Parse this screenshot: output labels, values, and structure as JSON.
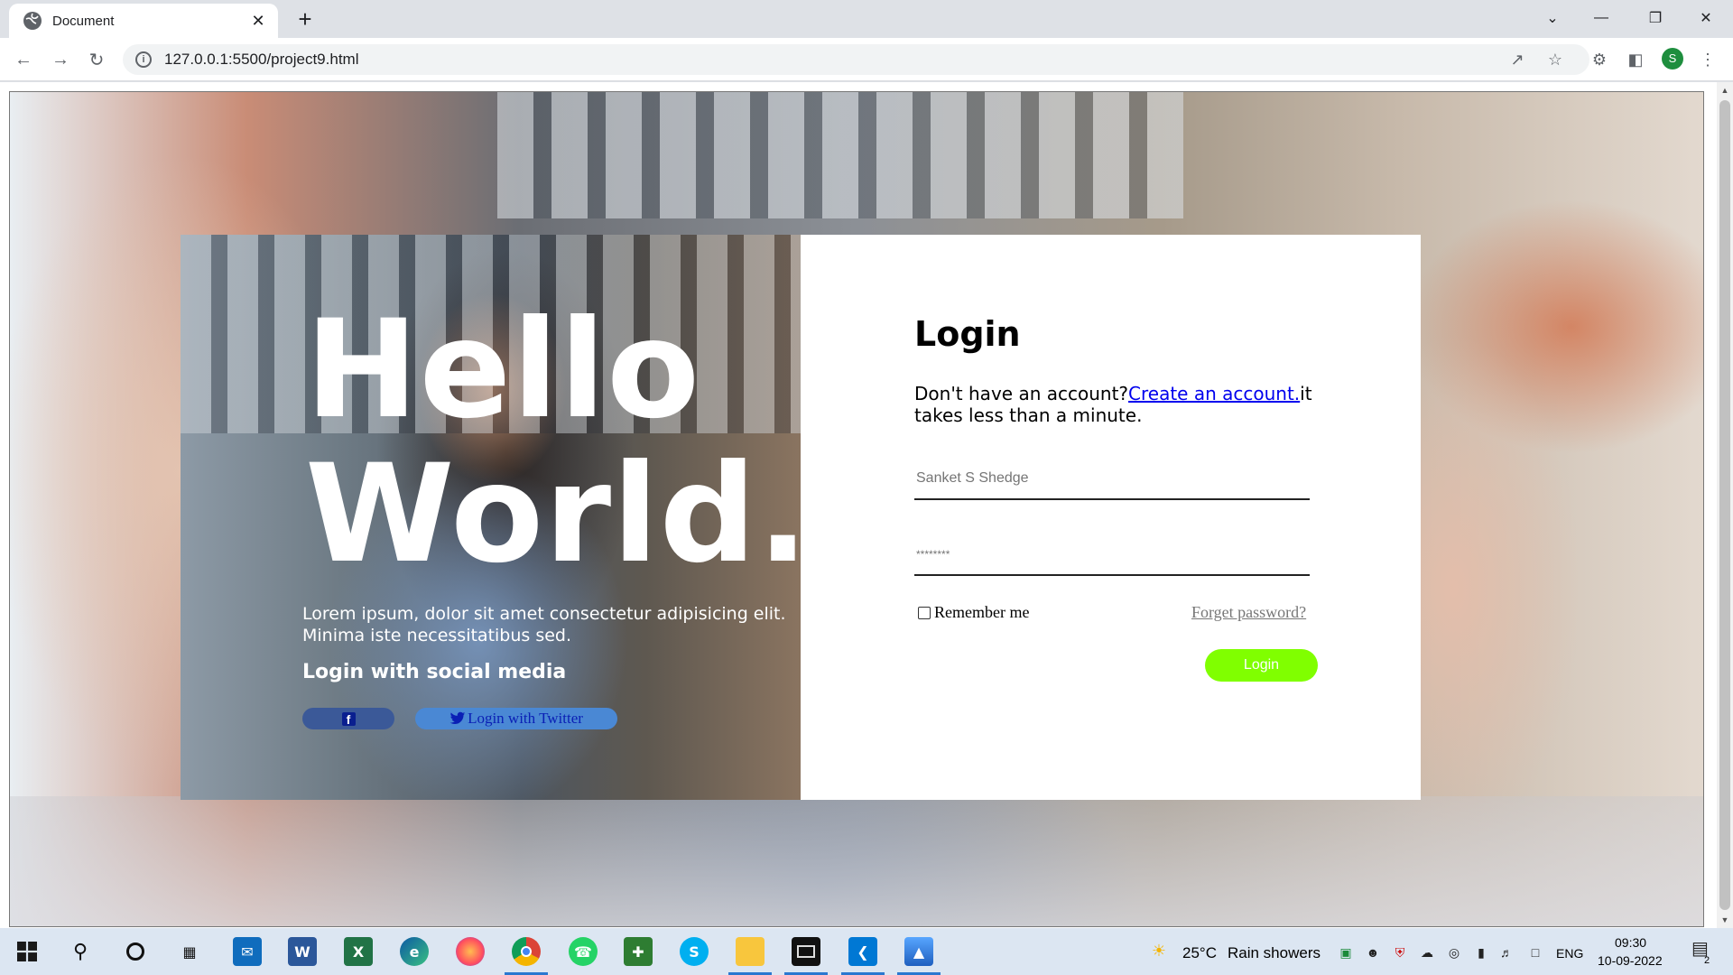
{
  "browser": {
    "tab_title": "Document",
    "tab_close": "✕",
    "new_tab": "+",
    "url": "127.0.0.1:5500/project9.html",
    "profile_initial": "S",
    "window_controls": [
      "⌄",
      "—",
      "❐",
      "✕"
    ]
  },
  "hero": {
    "line1": "Hello",
    "line2": "World.",
    "lorem": "Lorem ipsum, dolor sit amet consectetur adipisicing elit. Minima iste necessitatibus sed.",
    "social_title": "Login with social media",
    "facebook_glyph": "f",
    "twitter_label": "Login with Twitter"
  },
  "login": {
    "title": "Login",
    "signup_prefix": "Don't have an account?",
    "signup_link": "Create an account.",
    "signup_suffix": "it takes less than a minute.",
    "username_placeholder": "Sanket S Shedge",
    "password_placeholder": "********",
    "remember_label": "Remember me",
    "forgot_label": "Forget password?",
    "button_label": "Login",
    "button_color": "#80ff00"
  },
  "taskbar": {
    "weather_temp": "25°C",
    "weather_text": "Rain showers",
    "language": "ENG",
    "time": "09:30",
    "date": "10-09-2022",
    "notification_count": "2",
    "apps": [
      "windows-start-icon",
      "search-icon",
      "cortana-icon",
      "task-view-icon",
      "mail-icon",
      "word-icon",
      "excel-icon",
      "edge-icon",
      "firefox-icon",
      "chrome-icon",
      "whatsapp-icon",
      "app-icon",
      "skype-icon",
      "file-explorer-icon",
      "terminal-icon",
      "vscode-icon",
      "photos-icon"
    ]
  }
}
